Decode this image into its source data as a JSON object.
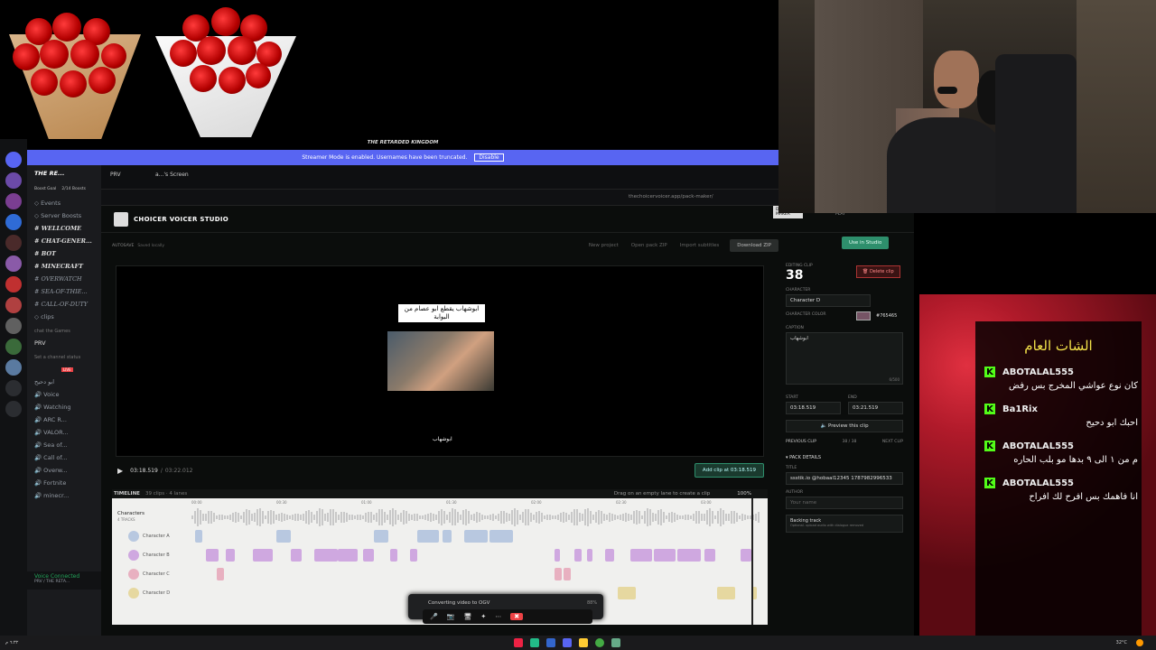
{
  "discord": {
    "server_name": "THE RE...",
    "top_server_label": "THE RETARDED KINGDOM",
    "banner_text": "Streamer Mode is enabled. Usernames have been truncated.",
    "banner_button": "Disable",
    "boost_goal": "Boost Goal",
    "boost_count": "2/14 Boosts",
    "tab_prv": "PRV",
    "tab_screen": "a...'s Screen",
    "channels": [
      {
        "label": "Events",
        "type": "plain"
      },
      {
        "label": "Server Boosts",
        "type": "plain"
      },
      {
        "label": "WELLCOME",
        "type": "bold"
      },
      {
        "label": "CHAT-GENER...",
        "type": "bold"
      },
      {
        "label": "BOT",
        "type": "bold"
      },
      {
        "label": "MINECRAFT",
        "type": "bold"
      },
      {
        "label": "OVERWATCH",
        "type": "italic"
      },
      {
        "label": "SEA-OF-THIE...",
        "type": "italic"
      },
      {
        "label": "CALL-OF-DUTY",
        "type": "italic"
      },
      {
        "label": "clips",
        "type": "plain"
      }
    ],
    "category_games": "chat the Games",
    "voice_channel": "PRV",
    "voice_status": "Set a channel status",
    "voice_badge_live": "LIVE",
    "voice_member2": "ابو دحيح",
    "voice_channels": [
      "Voice",
      "Watching",
      "ARC R...",
      "VALOR...",
      "Sea of...",
      "Call of...",
      "Overw...",
      "Fortnite",
      "minecr..."
    ],
    "voice_connected": "Voice Connected",
    "voice_connected_sub": "PRV / THE RETA..."
  },
  "browser": {
    "url": "thechoicervoicer.app/pack-maker/"
  },
  "app": {
    "brand": "CHOICER VOICER STUDIO",
    "nav": [
      "DUB PACK MAKER",
      "STUDIO",
      "HOW TO PLAY",
      "TUTORIALS",
      "ABOUT"
    ],
    "autosave_label": "AUTOSAVE",
    "autosave_status": "Saved locally",
    "actions": [
      "New project",
      "Open pack ZIP",
      "Import subtitles"
    ],
    "download_button": "Download ZIP",
    "use_button": "Use in Studio",
    "caption_text": "ابوشهاب يقطع ابو عصام من البوابة",
    "subtitle_bottom": "ابوشهاب",
    "time_current": "03:18.519",
    "time_total": "03:22.012",
    "add_clip_button": "Add clip at 03:18.519",
    "timeline_title": "TIMELINE",
    "timeline_meta": "39 clips · 4 lanes",
    "timeline_hint": "Drag on an empty lane to create a clip",
    "zoom": "100%",
    "characters_label": "Characters",
    "characters_sub": "4 TRACKS",
    "lanes": [
      "Character A",
      "Character B",
      "Character C",
      "Character D"
    ],
    "ticks": [
      "00:00",
      "00:30",
      "01:00",
      "01:30",
      "02:00",
      "02:30",
      "03:00"
    ]
  },
  "side": {
    "clip_label": "EDITING CLIP",
    "clip_number": "38",
    "delete_button": "Delete clip",
    "character_label": "CHARACTER",
    "character_value": "Character D",
    "color_label": "CHARACTER COLOR",
    "color_hex": "#765465",
    "caption_label": "CAPTION",
    "caption_value": "ابوشهاب",
    "caption_count": "6/500",
    "start_label": "START",
    "start_value": "03:18.519",
    "end_label": "END",
    "end_value": "03:21.519",
    "preview_button": "Preview this clip",
    "prev_clip": "PREVIOUS CLIP",
    "clip_pos": "38 / 38",
    "next_clip": "NEXT CLIP",
    "pack_details": "PACK DETAILS",
    "title_label": "TITLE",
    "title_value": "ssstik.io @hobaal12345 1787982996533",
    "author_label": "AUTHOR",
    "author_placeholder": "Your name",
    "backing_label": "Backing track",
    "backing_sub": "Optional. upload audio with dialogue removed"
  },
  "chat": {
    "title": "الشات العام",
    "messages": [
      {
        "user": "ABOTALAL555",
        "text": "كان نوع عواشي المخرج بس رفض"
      },
      {
        "user": "Ba1Rix",
        "text": "احبك ابو دحيح"
      },
      {
        "user": "ABOTALAL555",
        "text": "م من ١ الى ٩ بدها مو بلب الحاره"
      },
      {
        "user": "ABOTALAL555",
        "text": "انا فاهمك بس افرح لك افراح"
      }
    ]
  },
  "toast": {
    "text": "Converting video to OGV",
    "percent": "88%"
  },
  "taskbar": {
    "time": "٦:٣٢ م",
    "weather": "32°C"
  }
}
